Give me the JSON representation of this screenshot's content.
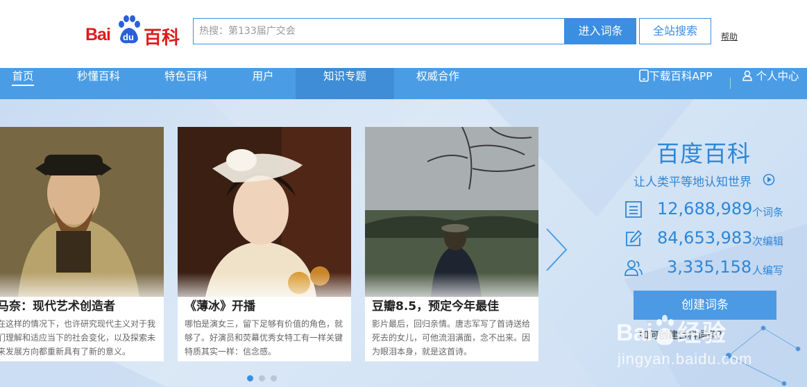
{
  "header": {
    "logo_text_bai": "Bai",
    "logo_text_du": "du",
    "logo_text_baike": "百科",
    "search_placeholder": "热搜：第133届广交会",
    "enter_button": "进入词条",
    "site_search_button": "全站搜索",
    "help_link": "帮助"
  },
  "nav": {
    "items": [
      {
        "label": "首页"
      },
      {
        "label": "秒懂百科"
      },
      {
        "label": "特色百科"
      },
      {
        "label": "用户"
      },
      {
        "label": "知识专题"
      },
      {
        "label": "权威合作"
      }
    ],
    "download_app": "下载百科APP",
    "user_center": "个人中心"
  },
  "carousel": {
    "cards": [
      {
        "title": "马奈：现代艺术创造者",
        "desc": "在这样的情况下，也许研究现代主义对于我们理解和适应当下的社会变化，以及探索未来发展方向都重新具有了新的意义。"
      },
      {
        "title": "《薄冰》开播",
        "desc": "哪怕是演女三，留下足够有价值的角色，就够了。好演员和荧幕优秀女特工有一样关键特质其实一样：信念感。"
      },
      {
        "title": "豆瓣8.5，预定今年最佳",
        "desc": "影片最后，回归亲情。唐志军写了首诗送给死去的女儿，可他流泪满面，念不出来。因为眼泪本身，就是这首诗。"
      }
    ],
    "dots": 3,
    "active_dot": 0
  },
  "sidebar": {
    "brand": "百度百科",
    "slogan": "让人类平等地认知世界",
    "stats": [
      {
        "icon": "entries-icon",
        "value": "12,688,989",
        "unit": "个词条"
      },
      {
        "icon": "edit-icon",
        "value": "84,653,983",
        "unit": "次编辑"
      },
      {
        "icon": "users-icon",
        "value": "3,335,158",
        "unit": "人编写"
      }
    ],
    "create_button": "创建词条",
    "help_text": "如何创建百科词条？"
  },
  "watermark": {
    "title": "经验",
    "url": "jingyan.baidu.com"
  },
  "colors": {
    "brand_red": "#de1a1a",
    "accent_blue": "#3b8ee0",
    "nav_blue": "#4a9de5"
  }
}
